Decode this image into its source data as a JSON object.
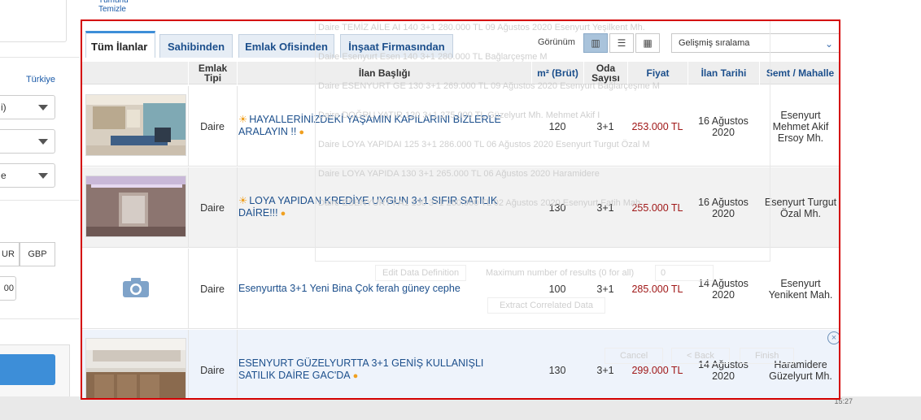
{
  "sidebar": {
    "clear_all": "Tümünü Temizle",
    "country_link": "Türkiye",
    "select_1": "i)",
    "select_2": "",
    "select_3": "e",
    "currencies": [
      "UR",
      "GBP"
    ],
    "amount_value": "00"
  },
  "toolbar": {
    "tabs": [
      "Tüm İlanlar",
      "Sahibinden",
      "Emlak Ofisinden",
      "İnşaat Firmasından"
    ],
    "view_label": "Görünüm",
    "view_icons": [
      "grid-view-icon",
      "list-view-icon",
      "gallery-view-icon"
    ],
    "sort_value": "Gelişmiş sıralama"
  },
  "table": {
    "headers": {
      "type": "Emlak Tipi",
      "title": "İlan Başlığı",
      "area": "m² (Brüt)",
      "rooms": "Oda Sayısı",
      "price": "Fiyat",
      "date": "İlan Tarihi",
      "location": "Semt / Mahalle"
    },
    "rows": [
      {
        "type": "Daire",
        "title": "HAYALLERİNİZDEKİ YAŞAMIN KAPILARINI BİZLERLE ARALAYIN !!",
        "area": "120",
        "rooms": "3+1",
        "price": "253.000 TL",
        "date": "16 Ağustos 2020",
        "location": "Esenyurt Mehmet Akif Ersoy Mh."
      },
      {
        "type": "Daire",
        "title": "LOYA YAPIDAN KREDİYE UYGUN 3+1 SIFIR SATILIK DAİRE!!!",
        "area": "130",
        "rooms": "3+1",
        "price": "255.000 TL",
        "date": "16 Ağustos 2020",
        "location": "Esenyurt Turgut Özal Mh."
      },
      {
        "type": "Daire",
        "title": "Esenyurtta 3+1 Yeni Bina Çok ferah güney cephe",
        "area": "100",
        "rooms": "3+1",
        "price": "285.000 TL",
        "date": "14 Ağustos 2020",
        "location": "Esenyurt Yenikent Mah."
      },
      {
        "type": "Daire",
        "title": "ESENYURT GÜZELYURTTA 3+1 GENİŞ KULLANIŞLI SATILIK DAİRE GAC'DA",
        "area": "130",
        "rooms": "3+1",
        "price": "299.000 TL",
        "date": "14 Ağustos 2020",
        "location": "Haramidere Güzelyurt Mh."
      }
    ]
  },
  "overlay": {
    "lines": [
      "Daire  TEMİZ AİLE AI  140  3+1  280.000 TL  09 Ağustos 2020  Esenyurt Yeşilkent Mh.",
      "Daire  Esenyurt Esen  140  3+1  280.000 TL  Bağlarçeşme M",
      "Daire  ESENYURT GE  130  3+1  269.000 TL  09 Ağustos 2020  Esenyurt Bağlarçeşme M",
      "Daire  DOĞRU YATIR  120  3+1  275.000 TL  Güzelyurt Mh. Mehmet Akif I",
      "Daire  LOYA YAPIDAI  125  3+1  286.000 TL  06 Ağustos 2020  Esenyurt Turgut Özal M",
      "Daire  LOYA YAPIDA  130  3+1  265.000 TL  06 Ağustos 2020  Haramidere",
      "Daire  ESENYURT FA1  130  3+1  260.000 TL  02 Ağustos 2020  Esenyurt Fatih Mah."
    ],
    "edit_data": "Edit Data Definition",
    "max_results": "Maximum number of results (0 for all)",
    "max_value": "0",
    "extract": "Extract Correlated Data",
    "cancel": "Cancel",
    "back": "< Back",
    "finish": "Finish"
  },
  "status": {
    "clock": "15:27"
  },
  "colors": {
    "accent": "#3d8ed8",
    "link": "#1c4f8c",
    "price": "#a01818",
    "highlight_border": "#d40000"
  }
}
